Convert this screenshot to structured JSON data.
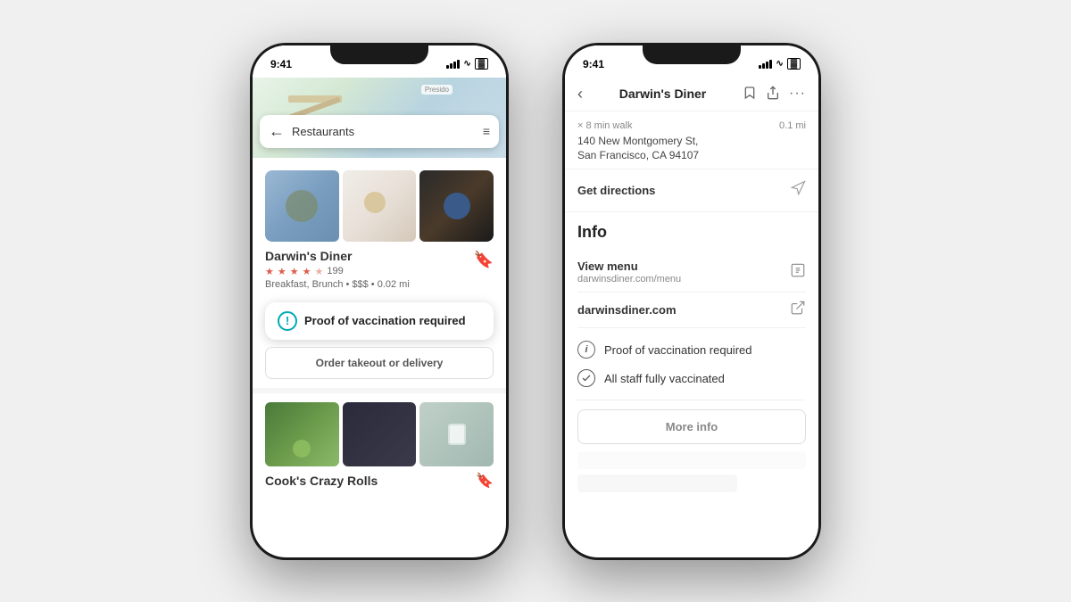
{
  "phone1": {
    "status": {
      "time": "9:41",
      "signal": true,
      "wifi": true,
      "battery": true
    },
    "search": {
      "placeholder": "Restaurants"
    },
    "restaurant1": {
      "name": "Darwin's Diner",
      "rating": 4.5,
      "review_count": "199",
      "meta": "Breakfast, Brunch  •  $$$  •  0.02 mi"
    },
    "vaccination_badge": {
      "text": "Proof of vaccination required"
    },
    "order_button": "Order takeout or delivery",
    "restaurant2": {
      "name": "Cook's Crazy Rolls"
    }
  },
  "phone2": {
    "status": {
      "time": "9:41"
    },
    "header": {
      "title": "Darwin's Diner",
      "back": "‹",
      "bookmark": "⊘",
      "share": "⬆",
      "more": "•••"
    },
    "address": {
      "walk": "× 8 min walk",
      "time_away": "0.1 mi",
      "line1": "140 New Montgomery St,",
      "line2": "San Francisco, CA 94107"
    },
    "directions": {
      "label": "Get directions"
    },
    "info": {
      "heading": "Info",
      "menu": {
        "label": "View menu",
        "url": "darwinsdiner.com/menu"
      },
      "website": {
        "label": "darwinsdiner.com"
      },
      "health_items": [
        {
          "type": "warning",
          "text": "Proof of vaccination required"
        },
        {
          "type": "check",
          "text": "All staff fully vaccinated"
        }
      ],
      "more_info_label": "More info"
    }
  }
}
